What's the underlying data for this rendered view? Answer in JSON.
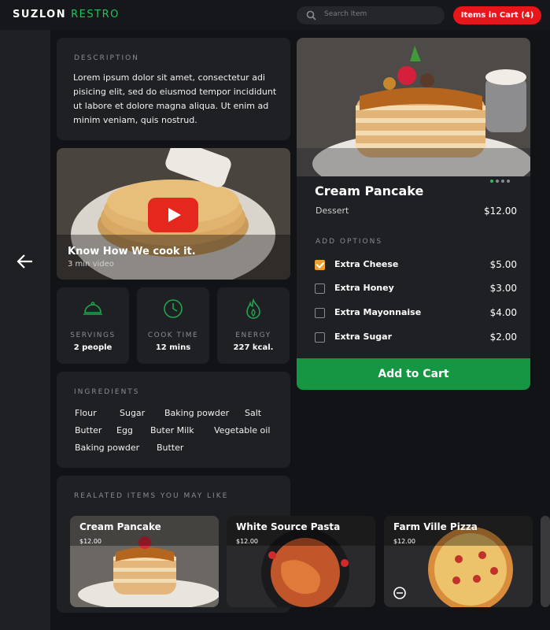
{
  "header": {
    "brand_primary": "SUZLON",
    "brand_secondary": "RESTRO",
    "search_placeholder": "Search Item",
    "cart_label": "Items in Cart (4)"
  },
  "description": {
    "label": "DESCRIPTION",
    "text": "Lorem ipsum dolor sit amet, consectetur adi pisicing elit, sed do eiusmod tempor incididunt ut labore et dolore magna aliqua. Ut enim ad minim veniam, quis nostrud."
  },
  "video": {
    "title": "Know How We cook it.",
    "subtitle": "3 min video"
  },
  "stats": [
    {
      "label": "SERVINGS",
      "value": "2 people",
      "icon": "cloche-icon"
    },
    {
      "label": "COOK TIME",
      "value": "12 mins",
      "icon": "clock-icon"
    },
    {
      "label": "ENERGY",
      "value": "227 kcal.",
      "icon": "flame-icon"
    }
  ],
  "ingredients": {
    "label": "INGREDIENTS",
    "items": [
      "Flour",
      "Sugar",
      "Baking powder",
      "Salt",
      "Butter",
      "Egg",
      "Buter Milk",
      "Vegetable oil",
      "Baking powder",
      "Butter"
    ]
  },
  "related": {
    "label": "REALATED ITEMS YOU MAY LIKE",
    "items": [
      {
        "name": "Cream Pancake",
        "price": "$12.00"
      },
      {
        "name": "White Source Pasta",
        "price": "$12.00"
      },
      {
        "name": "Farm Ville Pizza",
        "price": "$12.00"
      }
    ]
  },
  "product": {
    "name": "Cream Pancake",
    "category": "Dessert",
    "price": "$12.00",
    "options_label": "ADD OPTIONS",
    "options": [
      {
        "name": "Extra Cheese",
        "price": "$5.00",
        "checked": true
      },
      {
        "name": "Extra Honey",
        "price": "$3.00",
        "checked": false
      },
      {
        "name": "Extra Mayonnaise",
        "price": "$4.00",
        "checked": false
      },
      {
        "name": "Extra Sugar",
        "price": "$2.00",
        "checked": false
      }
    ],
    "add_button": "Add to Cart"
  },
  "colors": {
    "accent_green": "#149642",
    "cart_red": "#e8151b",
    "checkbox_orange": "#f1a129"
  }
}
